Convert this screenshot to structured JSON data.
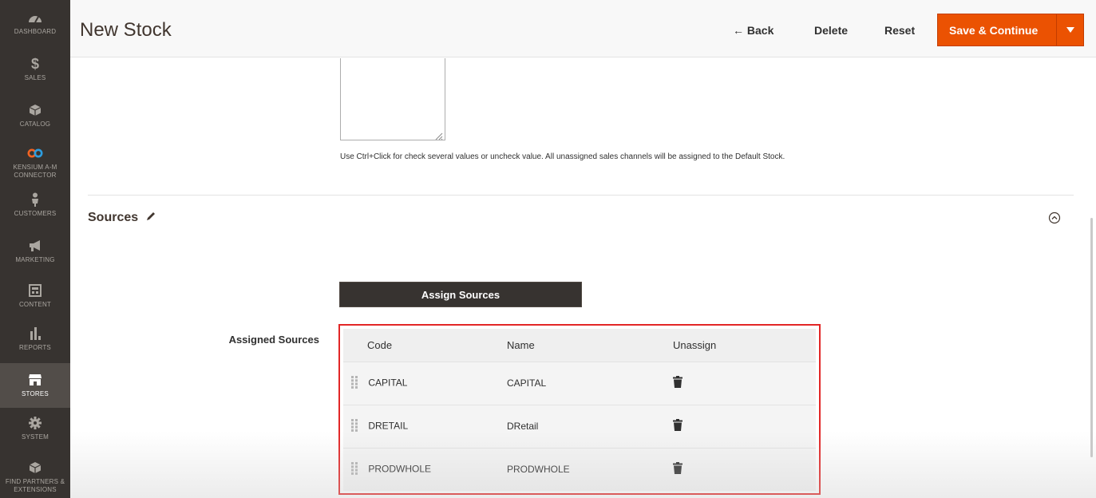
{
  "sidebar": {
    "items": [
      {
        "label": "DASHBOARD",
        "icon": "dashboard-icon"
      },
      {
        "label": "SALES",
        "icon": "dollar-icon"
      },
      {
        "label": "CATALOG",
        "icon": "cube-icon"
      },
      {
        "label": "KENSIUM A-M CONNECTOR",
        "icon": "infinity-icon"
      },
      {
        "label": "CUSTOMERS",
        "icon": "person-icon"
      },
      {
        "label": "MARKETING",
        "icon": "megaphone-icon"
      },
      {
        "label": "CONTENT",
        "icon": "layout-icon"
      },
      {
        "label": "REPORTS",
        "icon": "bar-chart-icon"
      },
      {
        "label": "STORES",
        "icon": "store-icon"
      },
      {
        "label": "SYSTEM",
        "icon": "gear-icon"
      },
      {
        "label": "FIND PARTNERS & EXTENSIONS",
        "icon": "box-icon"
      }
    ],
    "active_color": "#524d49"
  },
  "header": {
    "title": "New Stock",
    "back_label": "← Back",
    "delete_label": "Delete",
    "reset_label": "Reset",
    "save_label": "Save & Continue",
    "accent": "#eb5202"
  },
  "main": {
    "helper_text": "Use Ctrl+Click for check several values or uncheck value. All unassigned sales channels will be assigned to the Default Stock.",
    "sources_title": "Sources",
    "assign_button": "Assign Sources",
    "assigned_label": "Assigned Sources",
    "grid": {
      "columns": [
        "Code",
        "Name",
        "Unassign"
      ],
      "rows": [
        {
          "code": "CAPITAL",
          "name": "CAPITAL"
        },
        {
          "code": "DRETAIL",
          "name": "DRetail"
        },
        {
          "code": "PRODWHOLE",
          "name": "PRODWHOLE"
        }
      ],
      "highlight_color": "#e22626"
    }
  }
}
